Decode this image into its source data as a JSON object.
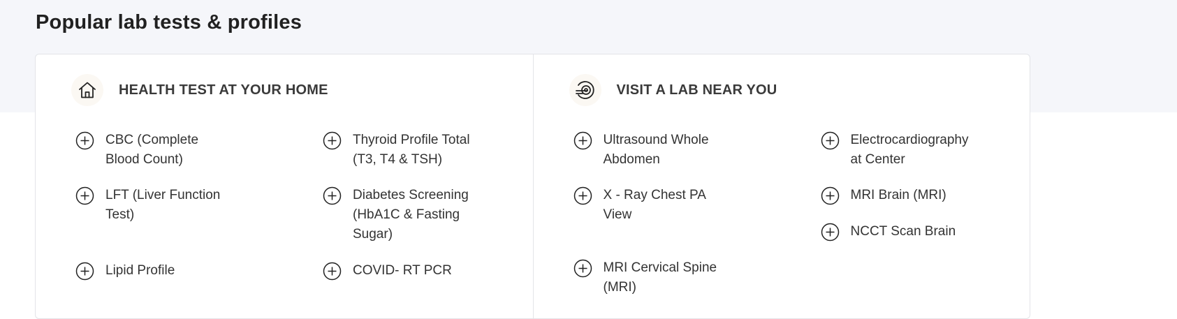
{
  "section_title": "Popular lab tests & profiles",
  "home": {
    "title": "HEALTH TEST AT YOUR HOME",
    "icon": "home-icon",
    "columns": [
      [
        {
          "line1": "CBC (Complete",
          "line2": "Blood Count)",
          "line3": ""
        },
        {
          "line1": "LFT (Liver Function",
          "line2": "Test)",
          "line3": ""
        },
        {
          "line1": "Lipid Profile",
          "line2": "",
          "line3": ""
        }
      ],
      [
        {
          "line1": "Thyroid Profile Total",
          "line2": "(T3, T4 & TSH)",
          "line3": ""
        },
        {
          "line1": "Diabetes Screening",
          "line2": "(HbA1C & Fasting",
          "line3": "Sugar)"
        },
        {
          "line1": "COVID- RT PCR",
          "line2": "",
          "line3": ""
        }
      ]
    ]
  },
  "lab": {
    "title": "VISIT A LAB NEAR YOU",
    "icon": "lab-scanner-icon",
    "columns": [
      [
        {
          "line1": "Ultrasound Whole",
          "line2": "Abdomen",
          "line3": ""
        },
        {
          "line1": "X - Ray Chest PA",
          "line2": "View",
          "line3": ""
        },
        {
          "line1": "MRI Cervical Spine",
          "line2": "(MRI)",
          "line3": ""
        }
      ],
      [
        {
          "line1": "Electrocardiography",
          "line2": "at Center",
          "line3": ""
        },
        {
          "line1": "MRI Brain (MRI)",
          "line2": "",
          "line3": ""
        },
        {
          "line1": "NCCT Scan Brain",
          "line2": "",
          "line3": ""
        }
      ]
    ]
  },
  "colors": {
    "background_band": "#f5f6fa",
    "card_border": "#e3e4e8",
    "text_primary": "#212121"
  }
}
